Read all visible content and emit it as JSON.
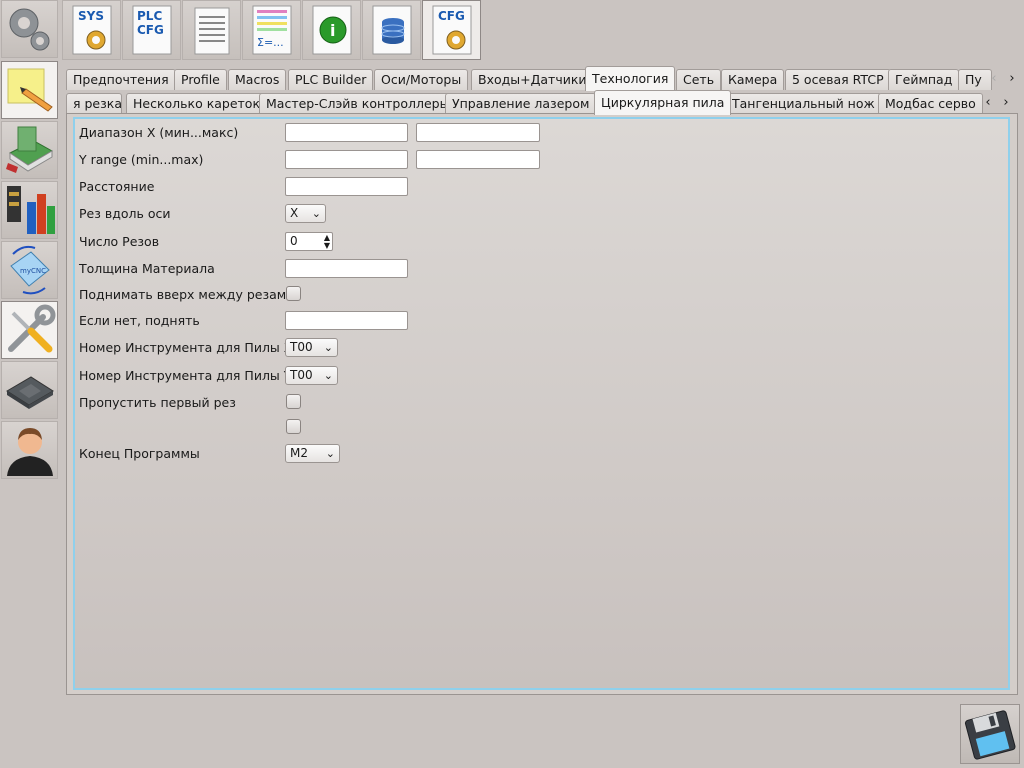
{
  "sidebar": {
    "items": [
      {
        "name": "settings",
        "icon": "gears-icon"
      },
      {
        "name": "editor",
        "icon": "pencil-note-icon"
      },
      {
        "name": "library",
        "icon": "books-icon"
      },
      {
        "name": "tools-stats",
        "icon": "tool-bars-icon"
      },
      {
        "name": "mycnc",
        "icon": "mycnc-rotate-icon",
        "label": "myCNC"
      },
      {
        "name": "tools",
        "icon": "wrench-screwdriver-icon",
        "active": true
      },
      {
        "name": "hardware",
        "icon": "chip-icon"
      },
      {
        "name": "user",
        "icon": "user-icon"
      }
    ]
  },
  "toolbar": {
    "items": [
      {
        "name": "sys",
        "label": "SYS"
      },
      {
        "name": "plc-cfg",
        "label1": "PLC",
        "label2": "CFG"
      },
      {
        "name": "report",
        "label": ""
      },
      {
        "name": "formula",
        "label": "Σ=..."
      },
      {
        "name": "info",
        "label": "i"
      },
      {
        "name": "database",
        "label": ""
      },
      {
        "name": "cfg",
        "label": "CFG"
      }
    ]
  },
  "tabs_row1": [
    "Предпочтения",
    "Profile",
    "Macros",
    "PLC Builder",
    "Оси/Моторы",
    "Входы+Датчики",
    "Технология",
    "Сеть",
    "Камера",
    "5 осевая RTCP",
    "Геймпад",
    "Пу"
  ],
  "tabs_row1_active": "Технология",
  "tabs_row2": [
    "я резка",
    "Несколько кареток",
    "Мастер-Слэйв контроллеры",
    "Управление лазером",
    "Циркулярная пила",
    "Тангенциальный нож",
    "Модбас серво"
  ],
  "tabs_row2_active": "Циркулярная пила",
  "form": {
    "x_range_label": "Диапазон X (мин...макс)",
    "y_range_label": "Y range (min...max)",
    "distance_label": "Расстояние",
    "cut_axis_label": "Рез вдоль оси",
    "cut_axis_value": "X",
    "cuts_count_label": "Число Резов",
    "cuts_count_value": "0",
    "thickness_label": "Толщина Материала",
    "lift_label": "Поднимать вверх между резами",
    "if_not_lift_label": "Если нет, поднять",
    "tool_x_label": "Номер Инструмента для Пилы X",
    "tool_x_value": "T00",
    "tool_y_label": "Номер Инструмента для Пилы Y",
    "tool_y_value": "T00",
    "skip_first_label": "Пропустить первый рез",
    "program_end_label": "Конец Программы",
    "program_end_value": "M2"
  },
  "colors": {
    "accent": "#8fd0ec"
  }
}
